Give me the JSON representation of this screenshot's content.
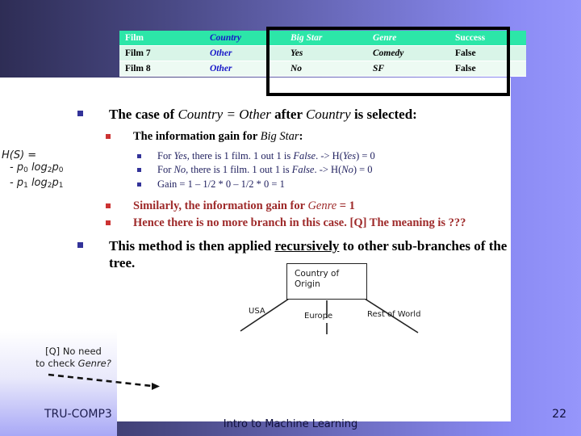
{
  "table": {
    "headers": [
      "Film",
      "Country",
      "Big Star",
      "Genre",
      "Success"
    ],
    "rows": [
      {
        "film": "Film 7",
        "country": "Other",
        "big_star": "Yes",
        "genre": "Comedy",
        "success": "False"
      },
      {
        "film": "Film 8",
        "country": "Other",
        "big_star": "No",
        "genre": "SF",
        "success": "False"
      }
    ]
  },
  "bullets": {
    "l1_case_pre": "The case of ",
    "l1_case_country1": "Country",
    "l1_case_eq": " = ",
    "l1_case_other": "Other",
    "l1_case_mid": " after ",
    "l1_case_country2": "Country",
    "l1_case_post": " is selected:",
    "l2_gain_pre": "The information gain for ",
    "l2_gain_var": "Big Star",
    "l2_gain_post": ":",
    "l3_yes_a": "For ",
    "l3_yes_var": "Yes",
    "l3_yes_b": ", there is 1 film. 1 out 1 is ",
    "l3_yes_false": "False",
    "l3_yes_c": ". -> H(",
    "l3_yes_var2": "Yes",
    "l3_yes_d": ") = 0",
    "l3_no_a": "For ",
    "l3_no_var": "No",
    "l3_no_b": ", there is 1 film. 1 out 1 is ",
    "l3_no_false": "False",
    "l3_no_c": ". -> H(",
    "l3_no_var2": "No",
    "l3_no_d": ") = 0",
    "l3_gain": "Gain = 1 – 1/2 * 0 – 1/2 * 0 = 1",
    "l2_similarly_pre": "Similarly, the information gain for ",
    "l2_similarly_var": "Genre",
    "l2_similarly_post": " = 1",
    "l2_hence": "Hence there is no more branch in this case. [Q] The meaning is ???",
    "l1_recursive_pre": "This method is then applied ",
    "l1_recursive_em": "recursively",
    "l1_recursive_post": " to other sub-branches of the tree."
  },
  "formula": {
    "line1": "H(S) =",
    "line2_a": "- p",
    "line2_sub1": "0",
    "line2_b": " log",
    "line2_sub2": "2",
    "line2_c": "p",
    "line2_sub3": "0",
    "line3_a": "- p",
    "line3_sub1": "1",
    "line3_b": " log",
    "line3_sub2": "2",
    "line3_c": "p",
    "line3_sub3": "1"
  },
  "tree": {
    "root_line1": "Country of",
    "root_line2": "Origin",
    "branch_usa": "USA",
    "branch_europe": "Europe",
    "branch_rest": "Rest of World"
  },
  "annotation": {
    "line1": "[Q] No need",
    "line2_pre": "to check ",
    "line2_em": "Genre?"
  },
  "footer": {
    "left": "TRU-COMP3",
    "center": "Intro to Machine Learning",
    "page": "22"
  },
  "colors": {
    "bg_left": "#2e2d55",
    "bg_right": "#9696fb",
    "table_header": "#2ce6a8",
    "table_row1": "#d9f5e8",
    "table_row2": "#edfaf3",
    "bullet_navy": "#333399",
    "bullet_red": "#cc3333",
    "text_red": "#9e2a2a",
    "text_navy": "#1717c8"
  }
}
